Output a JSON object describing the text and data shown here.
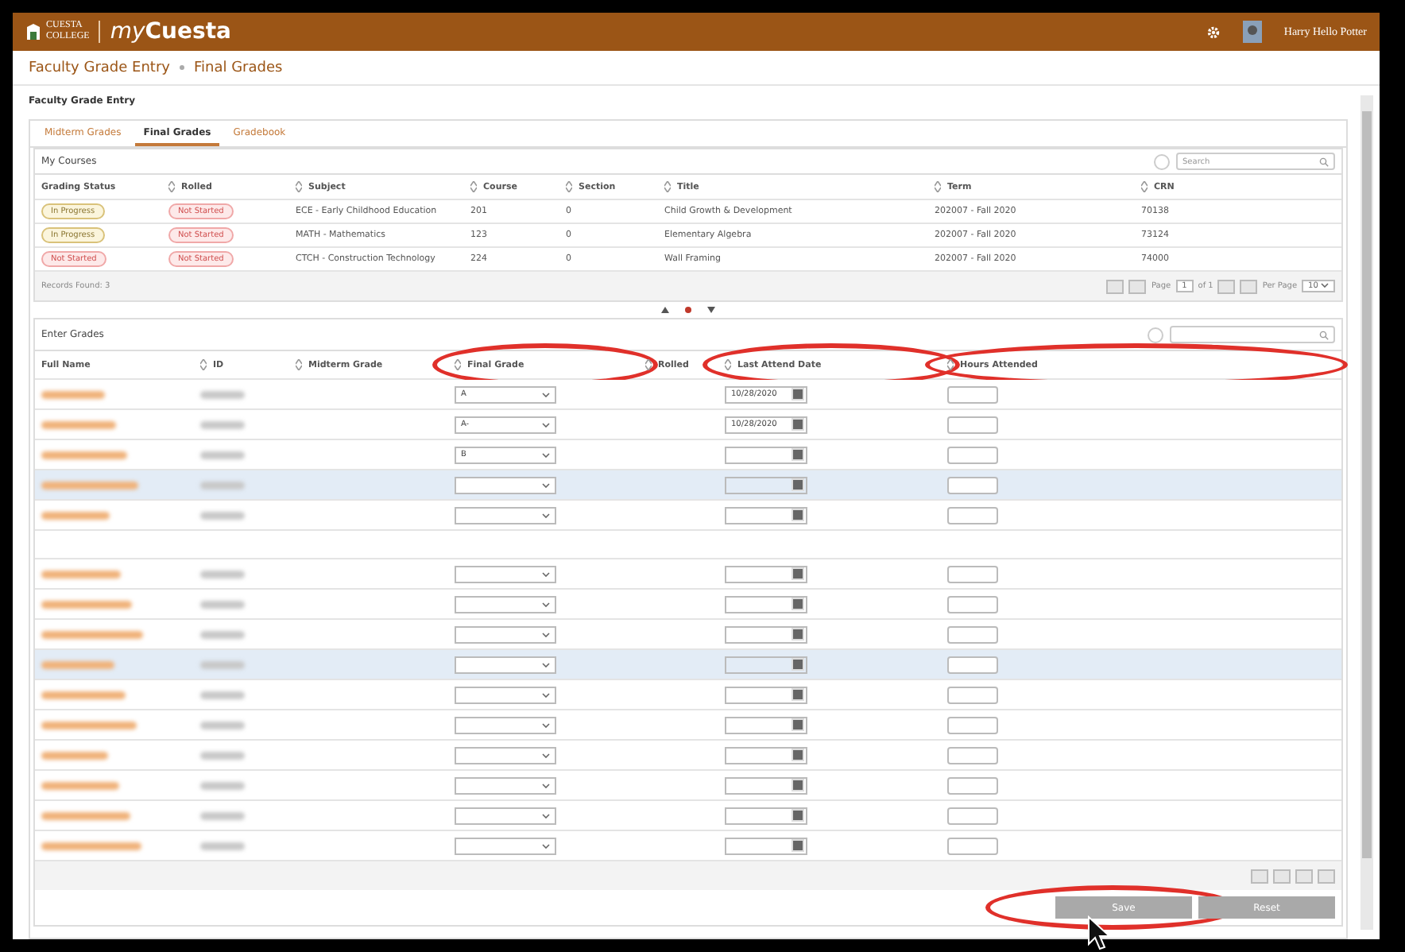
{
  "header": {
    "logo_top": "CUESTA",
    "logo_bottom": "COLLEGE",
    "brand_prefix": "my",
    "brand_name": "Cuesta",
    "user": "Harry Hello Potter"
  },
  "breadcrumb": [
    "Faculty Grade Entry",
    "Final Grades"
  ],
  "page_title": "Faculty Grade Entry",
  "tabs": [
    {
      "label": "Midterm Grades",
      "selected": false
    },
    {
      "label": "Final Grades",
      "selected": true
    },
    {
      "label": "Gradebook",
      "selected": false
    }
  ],
  "courses": {
    "title": "My Courses",
    "search": {
      "placeholder": "Search"
    },
    "columns": [
      "Grading Status",
      "Rolled",
      "Subject",
      "Course",
      "Section",
      "Title",
      "Term",
      "CRN"
    ],
    "rows": [
      {
        "status": {
          "text": "In Progress",
          "kind": "progress"
        },
        "rolled": {
          "text": "Not Started",
          "kind": "notstarted"
        },
        "subject": "ECE - Early Childhood Education",
        "course": "201",
        "section": "0",
        "title": "Child Growth & Development",
        "term": "202007 - Fall 2020",
        "crn": "70138"
      },
      {
        "status": {
          "text": "In Progress",
          "kind": "progress"
        },
        "rolled": {
          "text": "Not Started",
          "kind": "notstarted"
        },
        "subject": "MATH - Mathematics",
        "course": "123",
        "section": "0",
        "title": "Elementary Algebra",
        "term": "202007 - Fall 2020",
        "crn": "73124"
      },
      {
        "status": {
          "text": "Not Started",
          "kind": "notstarted"
        },
        "rolled": {
          "text": "Not Started",
          "kind": "notstarted"
        },
        "subject": "CTCH - Construction Technology",
        "course": "224",
        "section": "0",
        "title": "Wall Framing",
        "term": "202007 - Fall 2020",
        "crn": "74000"
      }
    ],
    "footer": "Records Found: 3",
    "pager": {
      "page_label": "Page",
      "page": "1",
      "of": "of 1",
      "per_page_label": "Per Page",
      "per_page": "10"
    }
  },
  "grades": {
    "title": "Enter Grades",
    "columns": [
      {
        "label": "Full Name",
        "circled": false
      },
      {
        "label": "ID",
        "circled": false
      },
      {
        "label": "Midterm Grade",
        "circled": false
      },
      {
        "label": "Final Grade",
        "circled": true
      },
      {
        "label": "Rolled",
        "circled": false
      },
      {
        "label": "Last Attend Date",
        "circled": true
      },
      {
        "label": "Hours Attended",
        "circled": true
      }
    ],
    "rows": [
      {
        "final_grade": "A",
        "last_attend": "10/28/2020",
        "selected": false
      },
      {
        "final_grade": "A-",
        "last_attend": "10/28/2020",
        "selected": false
      },
      {
        "final_grade": "B",
        "selected": false
      },
      {
        "selected": true
      },
      {
        "selected": false
      },
      {
        "selected": false,
        "split_before": true
      },
      {
        "selected": false
      },
      {
        "selected": false
      },
      {
        "selected": true
      },
      {
        "selected": false
      },
      {
        "selected": false
      },
      {
        "selected": false
      },
      {
        "selected": false
      },
      {
        "selected": false
      },
      {
        "selected": false
      }
    ],
    "buttons": [
      {
        "label": "Save",
        "circled": true
      },
      {
        "label": "Reset",
        "circled": false
      }
    ]
  }
}
